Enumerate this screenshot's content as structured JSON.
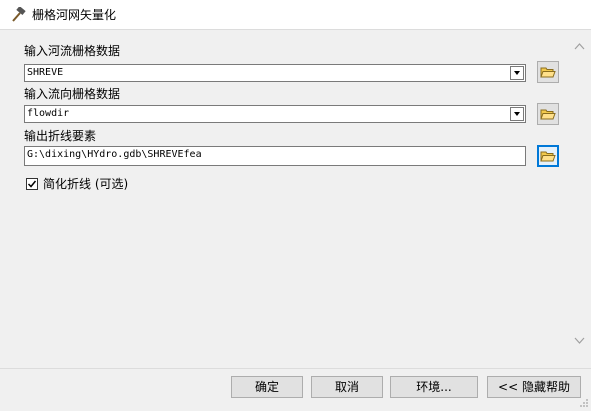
{
  "window": {
    "title": "栅格河网矢量化",
    "icon": "hammer-icon"
  },
  "form": {
    "stream_raster": {
      "label": "输入河流栅格数据",
      "value": "SHREVE"
    },
    "flow_direction": {
      "label": "输入流向栅格数据",
      "value": "flowdir"
    },
    "output_features": {
      "label": "输出折线要素",
      "value": "G:\\dixing\\HYdro.gdb\\SHREVEfea"
    },
    "simplify": {
      "label": "简化折线 (可选)",
      "checked": true
    }
  },
  "buttons": {
    "ok": "确定",
    "cancel": "取消",
    "environments": "环境...",
    "hide_help": "<< 隐藏帮助"
  },
  "colors": {
    "focus_border": "#0078d7",
    "folder_yellow": "#f2c94c"
  }
}
